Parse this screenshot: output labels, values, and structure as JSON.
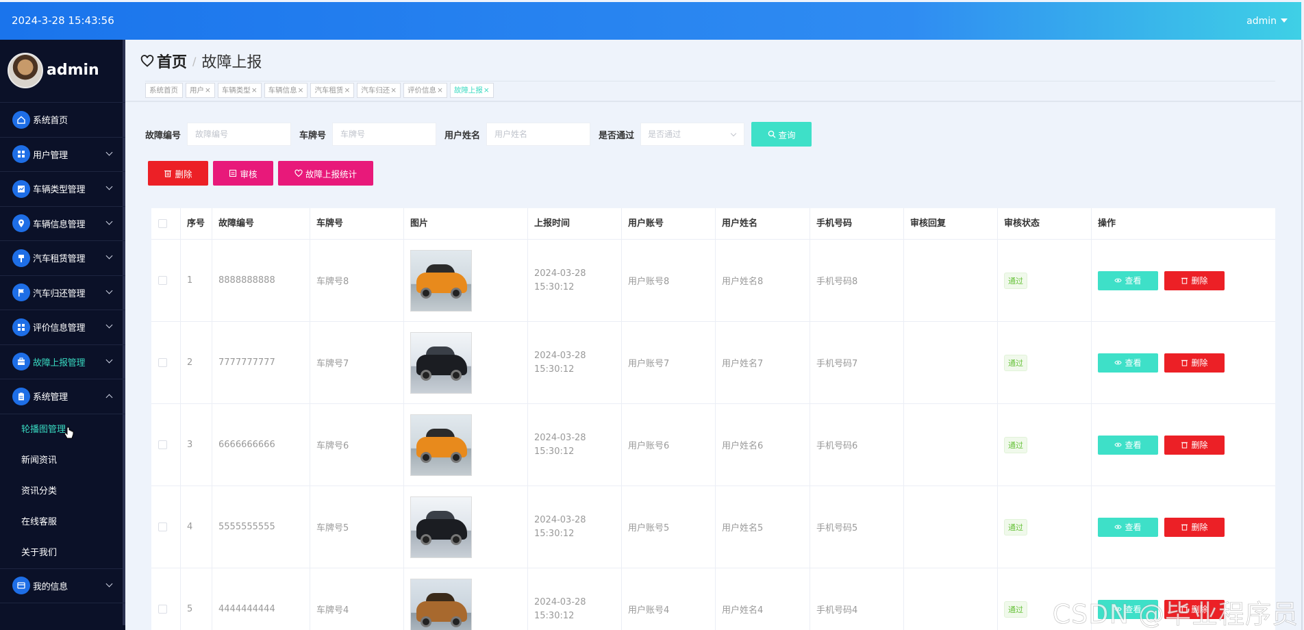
{
  "topbar": {
    "datetime": "2024-3-28 15:43:56",
    "user": "admin"
  },
  "sidebar": {
    "profile_name": "admin",
    "menu": [
      {
        "label": "系统首页",
        "icon": "home-icon"
      },
      {
        "label": "用户管理",
        "icon": "grid-icon"
      },
      {
        "label": "车辆类型管理",
        "icon": "chart-icon"
      },
      {
        "label": "车辆信息管理",
        "icon": "location-icon"
      },
      {
        "label": "汽车租赁管理",
        "icon": "pin-icon"
      },
      {
        "label": "汽车归还管理",
        "icon": "flag-icon"
      },
      {
        "label": "评价信息管理",
        "icon": "grid-icon"
      },
      {
        "label": "故障上报管理",
        "icon": "briefcase-icon"
      },
      {
        "label": "系统管理",
        "icon": "clipboard-icon"
      },
      {
        "label": "我的信息",
        "icon": "card-icon"
      }
    ],
    "submenu": [
      "轮播图管理",
      "新闻资讯",
      "资讯分类",
      "在线客服",
      "关于我们"
    ]
  },
  "breadcrumb": {
    "home": "首页",
    "separator": "/",
    "current": "故障上报"
  },
  "tags": [
    {
      "label": "系统首页",
      "close": ""
    },
    {
      "label": "用户",
      "close": "×"
    },
    {
      "label": "车辆类型",
      "close": "×"
    },
    {
      "label": "车辆信息",
      "close": "×"
    },
    {
      "label": "汽车租赁",
      "close": "×"
    },
    {
      "label": "汽车归还",
      "close": "×"
    },
    {
      "label": "评价信息",
      "close": "×"
    },
    {
      "label": "故障上报",
      "close": "×"
    }
  ],
  "search": {
    "fault_no_label": "故障编号",
    "fault_no_placeholder": "故障编号",
    "plate_label": "车牌号",
    "plate_placeholder": "车牌号",
    "name_label": "用户姓名",
    "name_placeholder": "用户姓名",
    "pass_label": "是否通过",
    "pass_placeholder": "是否通过",
    "query_label": "查询"
  },
  "actions": {
    "delete": "删除",
    "audit": "审核",
    "stat": "故障上报统计"
  },
  "table": {
    "headers": [
      "序号",
      "故障编号",
      "车牌号",
      "图片",
      "上报时间",
      "用户账号",
      "用户姓名",
      "手机号码",
      "审核回复",
      "审核状态",
      "操作"
    ],
    "rows": [
      {
        "idx": "1",
        "fault_no": "8888888888",
        "plate": "车牌号8",
        "image": "car-orange",
        "time": "2024-03-28 15:30:12",
        "account": "用户账号8",
        "name": "用户姓名8",
        "phone": "手机号码8",
        "reply": "",
        "status": "通过"
      },
      {
        "idx": "2",
        "fault_no": "7777777777",
        "plate": "车牌号7",
        "image": "car-black",
        "time": "2024-03-28 15:30:12",
        "account": "用户账号7",
        "name": "用户姓名7",
        "phone": "手机号码7",
        "reply": "",
        "status": "通过"
      },
      {
        "idx": "3",
        "fault_no": "6666666666",
        "plate": "车牌号6",
        "image": "car-orange",
        "time": "2024-03-28 15:30:12",
        "account": "用户账号6",
        "name": "用户姓名6",
        "phone": "手机号码6",
        "reply": "",
        "status": "通过"
      },
      {
        "idx": "4",
        "fault_no": "5555555555",
        "plate": "车牌号5",
        "image": "car-black",
        "time": "2024-03-28 15:30:12",
        "account": "用户账号5",
        "name": "用户姓名5",
        "phone": "手机号码5",
        "reply": "",
        "status": "通过"
      },
      {
        "idx": "5",
        "fault_no": "4444444444",
        "plate": "车牌号4",
        "image": "car-brown",
        "time": "2024-03-28 15:30:12",
        "account": "用户账号4",
        "name": "用户姓名4",
        "phone": "手机号码4",
        "reply": "",
        "status": "通过"
      }
    ],
    "view_label": "查看",
    "delete_label": "删除"
  },
  "watermark": "CSDN @毕业程序员",
  "colors": {
    "accent": "#3ee0c8",
    "danger": "#ec2026",
    "pink": "#e8197a",
    "sidebar": "#0b1128",
    "topbar": "#1a74ec"
  }
}
